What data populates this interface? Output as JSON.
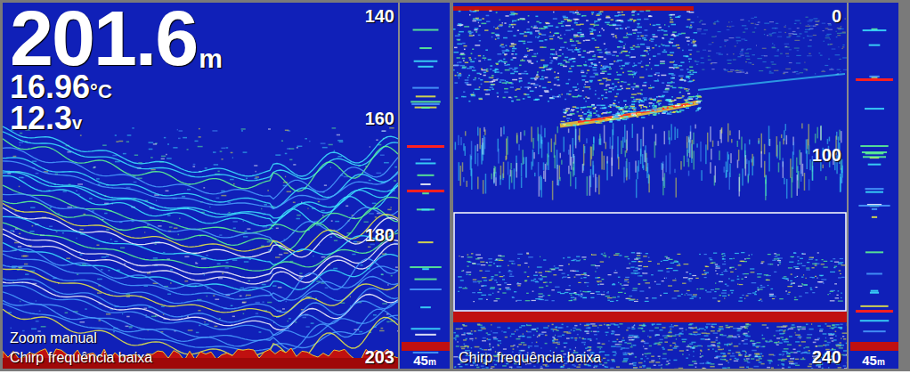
{
  "depth_reading": {
    "value": "201.6",
    "unit": "m"
  },
  "temperature": {
    "value": "16.96",
    "unit": "°C"
  },
  "voltage": {
    "value": "12.3",
    "unit": "v"
  },
  "left_panel": {
    "mode": "Zoom manual",
    "frequency": "Chirp frequência baixa",
    "depth_ticks": [
      "140",
      "160",
      "180"
    ],
    "range_end": "203",
    "flasher": {
      "range": "45",
      "unit": "m"
    }
  },
  "right_panel": {
    "frequency": "Chirp frequência baixa",
    "depth_ticks": [
      "0",
      "100"
    ],
    "range_end": "240",
    "flasher": {
      "range": "45",
      "unit": "m"
    }
  }
}
